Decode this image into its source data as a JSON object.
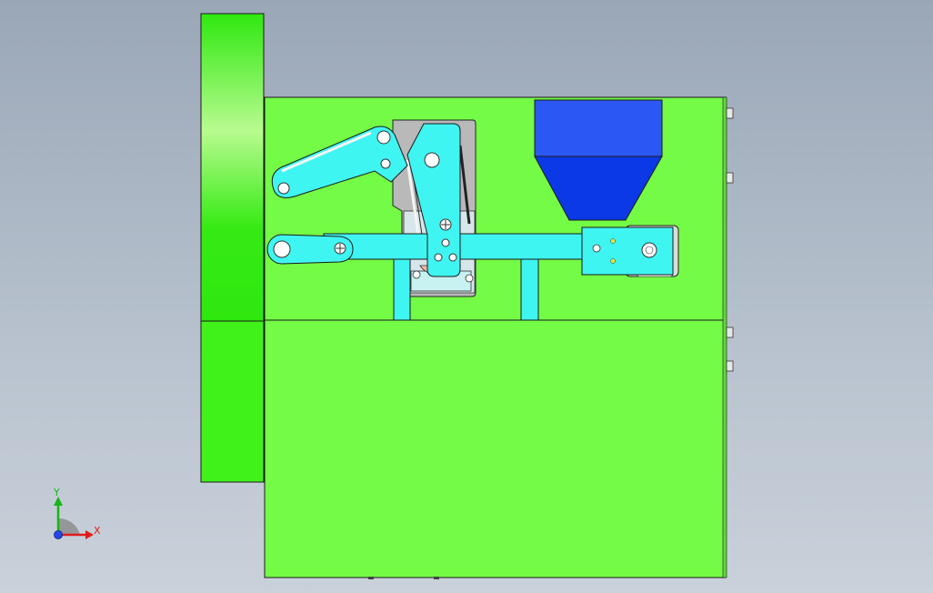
{
  "triad": {
    "x_label": "X",
    "y_label": "Y"
  },
  "colors": {
    "background_top": "#9aa7b7",
    "background_bottom": "#c9d1da",
    "frame_green": "#74fb46",
    "side_panel_green": "#41f21a",
    "linkage_cyan": "#3ff5f2",
    "hopper_blue": "#2b57f2",
    "hopper_blue_dark": "#0b39e6",
    "outline": "#1a1a1a",
    "axis_x": "#e01b1b",
    "axis_y": "#18b418",
    "axis_z": "#2446e8"
  }
}
